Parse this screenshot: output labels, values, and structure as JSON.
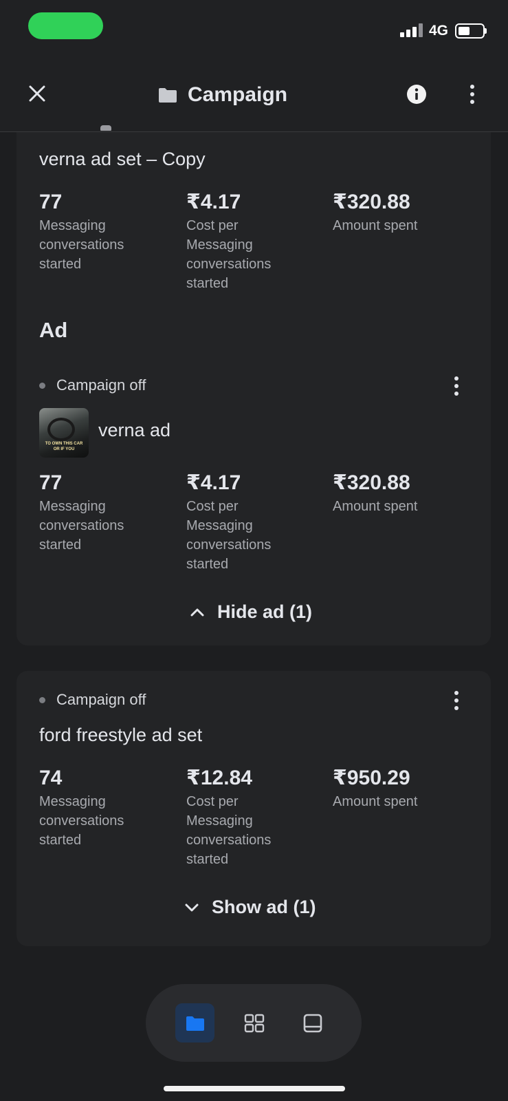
{
  "status_bar": {
    "network": "4G",
    "battery_level": 0.45
  },
  "header": {
    "title": "Campaign"
  },
  "section_title": "Ad",
  "adset_1": {
    "name": "verna ad set – Copy",
    "metrics": [
      {
        "value": "77",
        "label": "Messaging conversations started"
      },
      {
        "value": "₹4.17",
        "label": "Cost per Messaging conversations started"
      },
      {
        "value": "₹320.88",
        "label": "Amount spent"
      }
    ]
  },
  "ad_1": {
    "status": "Campaign off",
    "name": "verna ad",
    "thumbnail_caption": "TO OWN THIS CAR OR IF YOU",
    "metrics": [
      {
        "value": "77",
        "label": "Messaging conversations started"
      },
      {
        "value": "₹4.17",
        "label": "Cost per Messaging conversations started"
      },
      {
        "value": "₹320.88",
        "label": "Amount spent"
      }
    ],
    "toggle_label": "Hide ad (1)"
  },
  "adset_2": {
    "status": "Campaign off",
    "name": "ford freestyle ad set",
    "metrics": [
      {
        "value": "74",
        "label": "Messaging conversations started"
      },
      {
        "value": "₹12.84",
        "label": "Cost per Messaging conversations started"
      },
      {
        "value": "₹950.29",
        "label": "Amount spent"
      }
    ],
    "toggle_label": "Show ad (1)"
  },
  "bottom_nav": {
    "items": [
      {
        "icon": "folder-icon",
        "active": true
      },
      {
        "icon": "grid-icon",
        "active": false
      },
      {
        "icon": "tablet-icon",
        "active": false
      }
    ]
  },
  "colors": {
    "accent": "#1877f2",
    "status_on": "#30d158",
    "background": "#1d1e20",
    "card": "#232426"
  }
}
